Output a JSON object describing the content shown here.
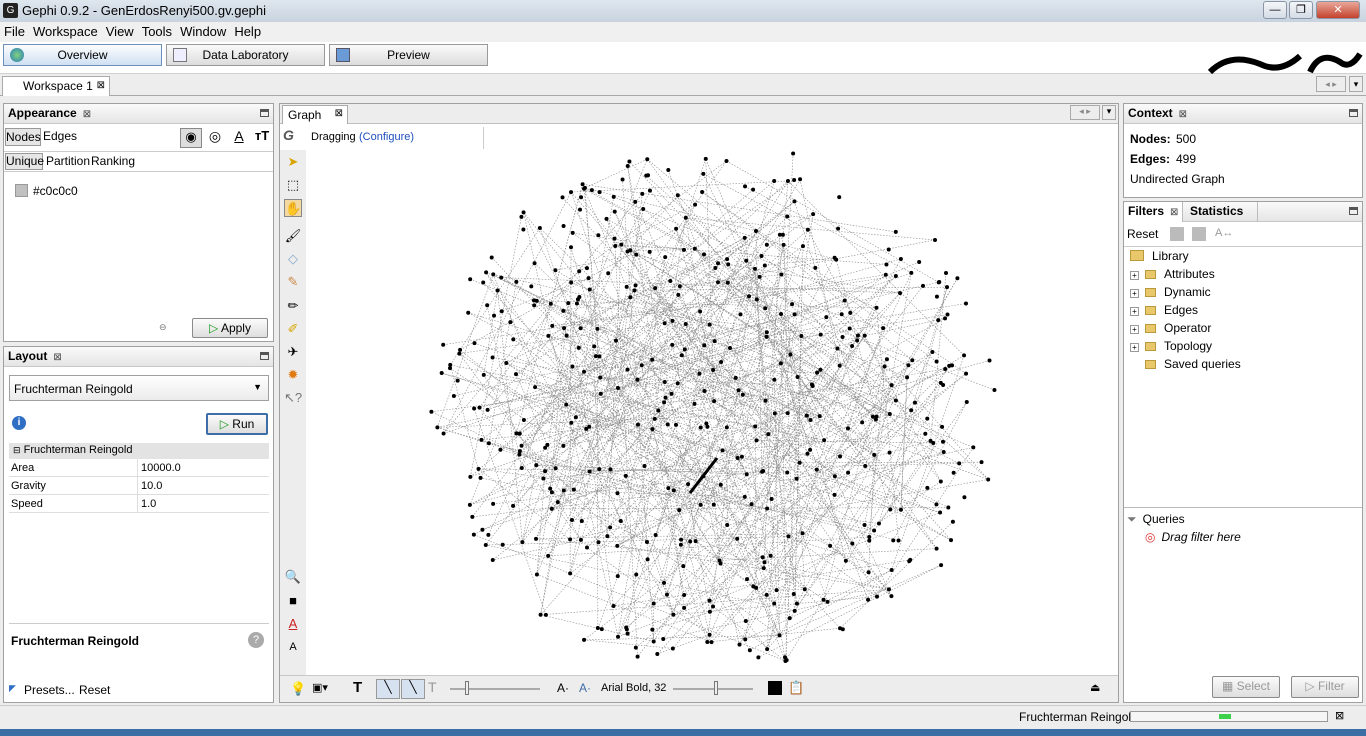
{
  "window": {
    "title": "Gephi 0.9.2 - GenErdosRenyi500.gv.gephi",
    "min": "—",
    "max": "❐",
    "close": "✕"
  },
  "menu": [
    "File",
    "Workspace",
    "View",
    "Tools",
    "Window",
    "Help"
  ],
  "modes": [
    {
      "label": "Overview"
    },
    {
      "label": "Data Laboratory"
    },
    {
      "label": "Preview"
    }
  ],
  "workspace_tab": "Workspace 1",
  "appearance": {
    "title": "Appearance",
    "tabs": [
      "Nodes",
      "Edges"
    ],
    "subtabs": [
      "Unique",
      "Partition",
      "Ranking"
    ],
    "color_value": "#c0c0c0",
    "apply_label": "Apply"
  },
  "layout": {
    "title": "Layout",
    "algorithm": "Fruchterman Reingold",
    "run_label": "Run",
    "section": "Fruchterman Reingold",
    "props": [
      {
        "key": "Area",
        "value": "10000.0"
      },
      {
        "key": "Gravity",
        "value": "10.0"
      },
      {
        "key": "Speed",
        "value": "1.0"
      }
    ],
    "desc_title": "Fruchterman Reingold",
    "presets_label": "Presets...",
    "reset_label": "Reset"
  },
  "graph": {
    "tab": "Graph",
    "mode": "Dragging",
    "configure": "(Configure)",
    "font_label": "Arial Bold, 32"
  },
  "context": {
    "title": "Context",
    "nodes_label": "Nodes:",
    "nodes_value": "500",
    "edges_label": "Edges:",
    "edges_value": "499",
    "graph_type": "Undirected Graph"
  },
  "filters": {
    "tab_filters": "Filters",
    "tab_statistics": "Statistics",
    "reset_label": "Reset",
    "library": "Library",
    "items": [
      "Attributes",
      "Dynamic",
      "Edges",
      "Operator",
      "Topology"
    ],
    "saved": "Saved queries",
    "queries": "Queries",
    "drag_hint": "Drag filter here",
    "select_label": "Select",
    "filter_label": "Filter"
  },
  "status": {
    "task": "Fruchterman Reingold",
    "progress": 0.06
  },
  "colors": {
    "accent": "#3d6ea8",
    "link": "#1f4fbf",
    "node": "#000000"
  }
}
